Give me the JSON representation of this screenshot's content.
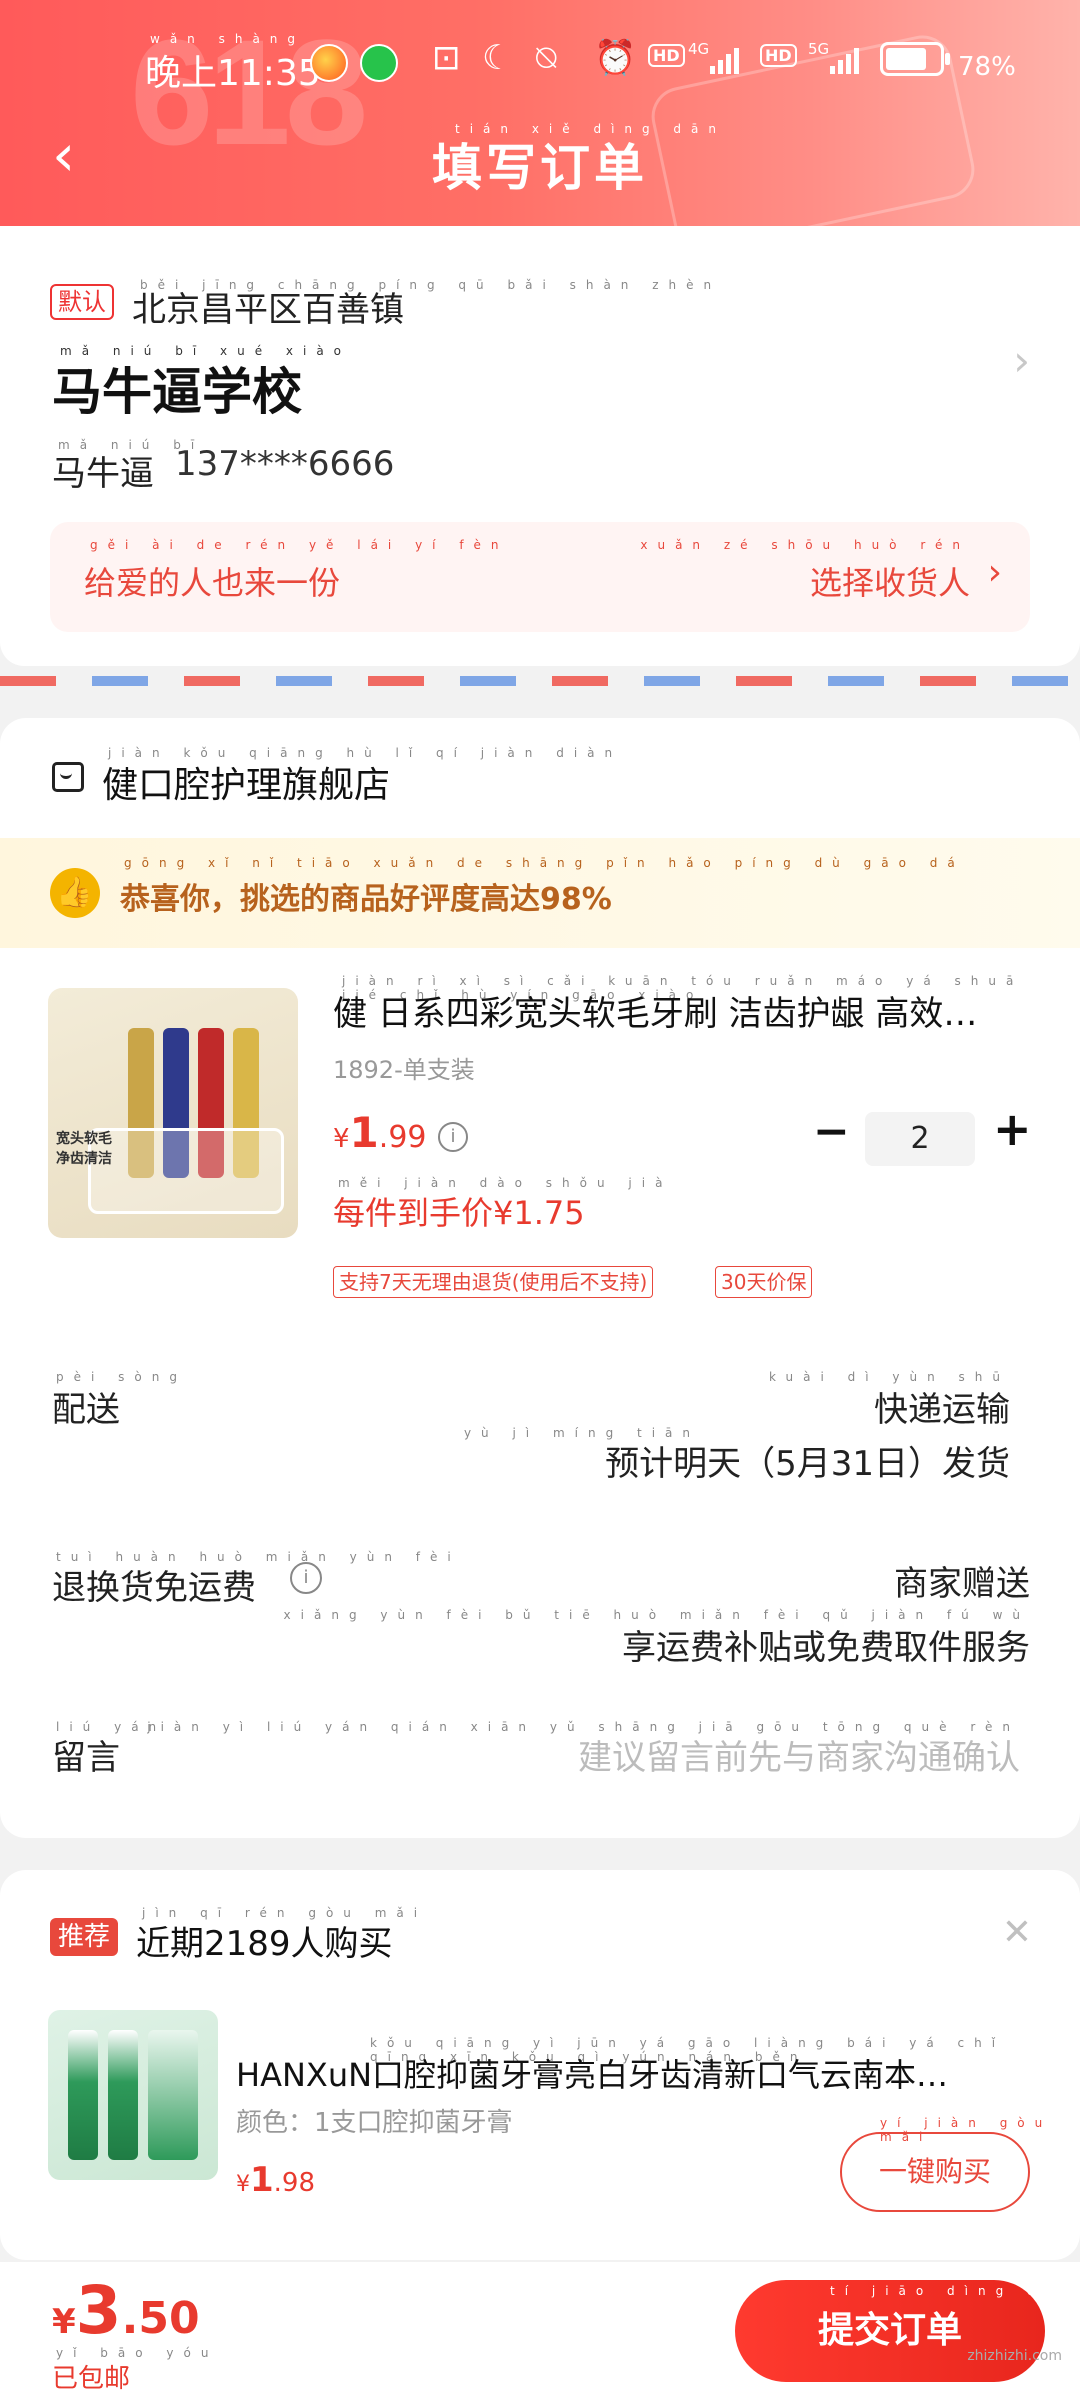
{
  "status_bar": {
    "time": "晚上11:35",
    "time_pinyin": "wǎn shàng",
    "net1": "4G",
    "net2": "5G",
    "hd": "HD",
    "battery": "78%"
  },
  "nav": {
    "title": "填写订单",
    "title_pinyin": "tián xiě dìng dān",
    "back_icon": "back-arrow-icon"
  },
  "address": {
    "default_badge": "默认",
    "region": "北京昌平区百善镇",
    "region_pinyin": "běi jīng chāng píng qū bǎi shàn zhèn",
    "name": "马牛逼学校",
    "name_pinyin": "mǎ niú bī xué xiào",
    "contact": "马牛逼",
    "contact_pinyin": "mǎ niú bī",
    "phone": "137****6666",
    "gift_text": "给爱的人也来一份",
    "gift_pinyin": "gěi ài de rén yě lái yí fèn",
    "select_receiver": "选择收货人",
    "select_pinyin": "xuǎn zé shōu huò rén"
  },
  "store": {
    "name": "健口腔护理旗舰店",
    "name_pinyin": "jiàn kǒu qiāng hù lǐ qí jiàn diàn",
    "praise": "恭喜你，挑选的商品好评度高达98%",
    "praise_pinyin": "gōng xǐ nǐ tiāo xuǎn de shāng pǐn hǎo píng dù gāo dá"
  },
  "product": {
    "title": "健 日系四彩宽头软毛牙刷 洁齿护龈 高效…",
    "title_pinyin": "jiàn rì xì sì cǎi kuān tóu ruǎn máo yá shuā jié chǐ hù yín gāo xiào",
    "sku": "1892-单支装",
    "price_currency": "¥",
    "price_int": "1",
    "price_dec": ".99",
    "quantity": "2",
    "unit_price": "每件到手价¥1.75",
    "unit_price_pinyin": "měi jiàn dào shǒu jià",
    "image_text": "宽头软毛 净齿清洁",
    "tags": [
      "支持7天无理由退货(使用后不支持)",
      "30天价保"
    ]
  },
  "delivery": {
    "label": "配送",
    "label_pinyin": "pèi sòng",
    "method": "快递运输",
    "method_pinyin": "kuài dì yùn shū",
    "eta": "预计明天（5月31日）发货",
    "eta_pinyin": "yù jì míng tiān"
  },
  "return_shipping": {
    "label": "退换货免运费",
    "label_pinyin": "tuì huàn huò miǎn yùn fèi",
    "value": "商家赠送",
    "desc": "享运费补贴或免费取件服务",
    "desc_pinyin": "xiǎng yùn fèi bǔ tiē huò miǎn fèi qǔ jiàn fú wù"
  },
  "message": {
    "label": "留言",
    "label_pinyin": "liú yán",
    "placeholder": "建议留言前先与商家沟通确认",
    "placeholder_pinyin": "jiàn yì liú yán qián xiān yǔ shāng jiā gōu tōng què rèn"
  },
  "recommend": {
    "badge": "推荐",
    "title": "近期2189人购买",
    "title_pinyin": "jìn qī rén gòu mǎi",
    "product_name": "HANXuN口腔抑菌牙膏亮白牙齿清新口气云南本…",
    "product_pinyin": "kǒu qiāng yì jūn yá gāo liàng bái yá chǐ qīng xīn kǒu qì yún nán běn",
    "spec": "颜色：1支口腔抑菌牙膏",
    "price_currency": "¥",
    "price_int": "1",
    "price_dec": ".98",
    "buy_button": "一键购买",
    "buy_pinyin": "yí jiàn gòu mǎi"
  },
  "footer": {
    "total_currency": "¥",
    "total_int": "3",
    "total_dec": ".50",
    "shipping": "已包邮",
    "shipping_pinyin": "yǐ bāo yóu",
    "submit": "提交订单",
    "submit_pinyin": "tí jiāo dìng dān",
    "watermark": "zhizhizhi.com"
  },
  "colors": {
    "accent": "#e8483c",
    "price": "#e83a2e",
    "header_start": "#ff5a5a",
    "praise_text": "#b7621d"
  }
}
